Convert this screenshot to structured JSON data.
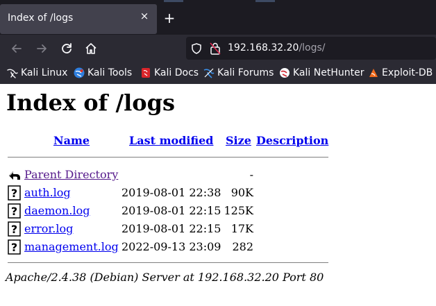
{
  "browser": {
    "tab_title": "Index of /logs",
    "tab_close": "×",
    "new_tab": "+",
    "url_host": "192.168.32.20",
    "url_path": "/logs/",
    "bookmarks": [
      {
        "label": "Kali Linux",
        "icon": "kali-dragon-icon"
      },
      {
        "label": "Kali Tools",
        "icon": "kali-tools-icon"
      },
      {
        "label": "Kali Docs",
        "icon": "kali-docs-icon"
      },
      {
        "label": "Kali Forums",
        "icon": "kali-forums-icon"
      },
      {
        "label": "Kali NetHunter",
        "icon": "kali-nethunter-icon"
      },
      {
        "label": "Exploit-DB",
        "icon": "exploit-db-icon"
      }
    ]
  },
  "page": {
    "heading": "Index of /logs",
    "columns": {
      "name": "Name",
      "modified": "Last modified",
      "size": "Size",
      "description": "Description"
    },
    "parent": {
      "name": "Parent Directory",
      "size": "-"
    },
    "files": [
      {
        "name": "auth.log",
        "modified": "2019-08-01 22:38",
        "size": "90K"
      },
      {
        "name": "daemon.log",
        "modified": "2019-08-01 22:15",
        "size": "125K"
      },
      {
        "name": "error.log",
        "modified": "2019-08-01 22:15",
        "size": "17K"
      },
      {
        "name": "management.log",
        "modified": "2022-09-13 23:09",
        "size": "282"
      }
    ],
    "footer": "Apache/2.4.38 (Debian) Server at 192.168.32.20 Port 80"
  },
  "colors": {
    "link": "#0000ee",
    "visited": "#551a8b",
    "chrome_dark": "#1c1b22",
    "chrome": "#2b2a33"
  }
}
